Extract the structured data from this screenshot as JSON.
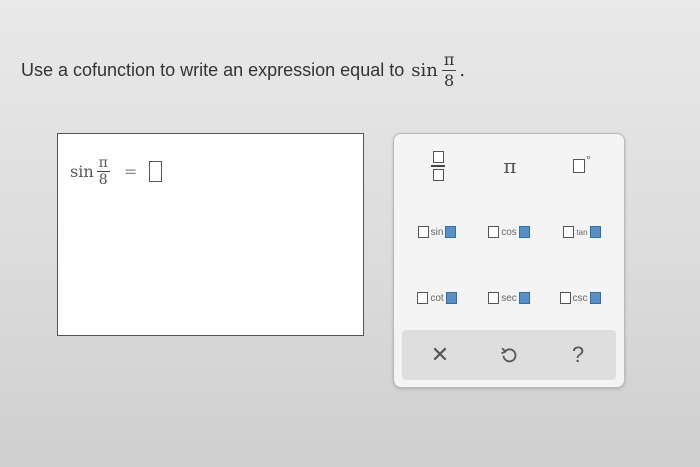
{
  "question": {
    "text": "Use a cofunction to write an expression equal to",
    "func": "sin",
    "numerator": "π",
    "denominator": "8",
    "end": "."
  },
  "answer": {
    "func": "sin",
    "numerator": "π",
    "denominator": "8",
    "equals": "=",
    "value": ""
  },
  "palette": {
    "pi": "π",
    "degree": "°",
    "trig_row1": [
      "sin",
      "cos",
      "tan"
    ],
    "trig_row2": [
      "cot",
      "sec",
      "csc"
    ],
    "clear": "✕",
    "help": "?"
  },
  "colors": {
    "template_square_fill": "#5b8ec3",
    "palette_bg": "#f4f4f4",
    "action_bar_bg": "#dedede"
  }
}
